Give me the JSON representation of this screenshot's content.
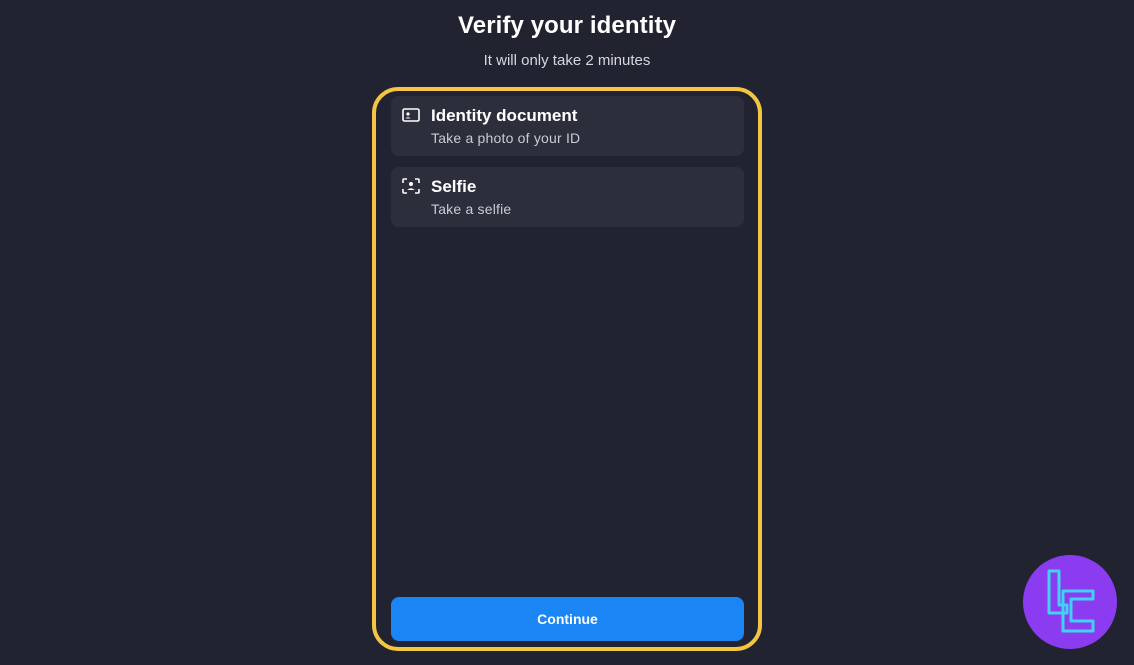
{
  "header": {
    "title": "Verify your identity",
    "subtitle": "It will only take 2 minutes"
  },
  "steps": [
    {
      "icon": "id-card-icon",
      "title": "Identity document",
      "description": "Take a photo of your ID"
    },
    {
      "icon": "face-scan-icon",
      "title": "Selfie",
      "description": "Take a selfie"
    }
  ],
  "actions": {
    "continue_label": "Continue"
  },
  "colors": {
    "background": "#222330",
    "card": "#2c2e3b",
    "accent": "#1a86f5",
    "highlight": "#f4c542",
    "logo_bg": "#8c3cf0",
    "logo_stroke": "#3fd2f5"
  },
  "brand": {
    "icon": "brand-logo-icon"
  }
}
